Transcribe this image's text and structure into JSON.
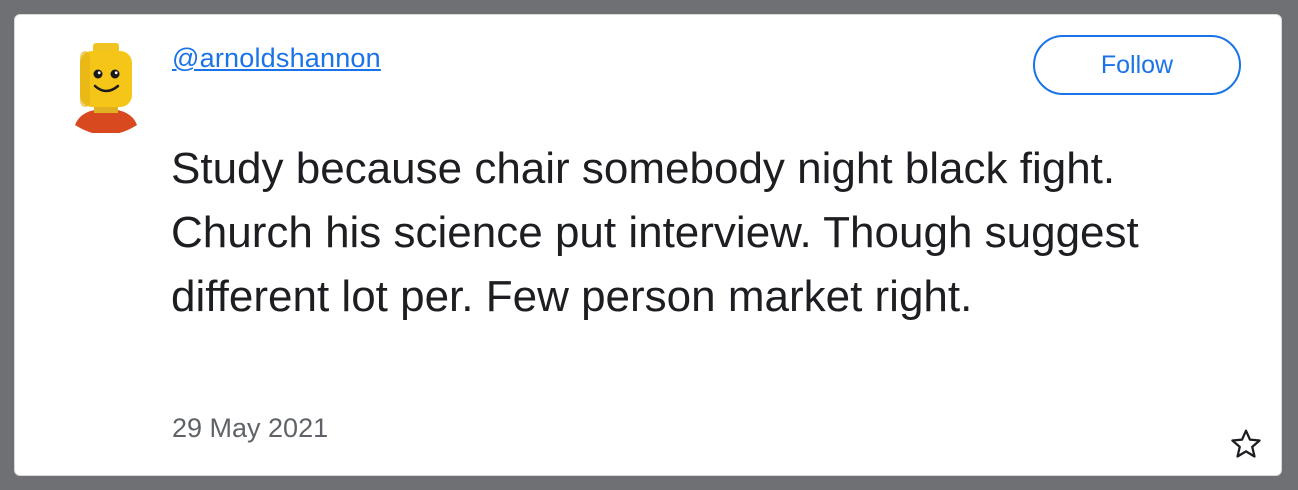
{
  "tweet": {
    "handle": "@arnoldshannon",
    "follow_label": "Follow",
    "text": "Study because chair somebody night black fight. Church his science put interview. Though suggest different lot per. Few person market right.",
    "date": "29 May 2021",
    "avatar_icon": "lego-head-avatar",
    "star_icon": "star-outline-icon"
  },
  "colors": {
    "accent": "#1a73e8",
    "background": "#6e7074",
    "card": "#ffffff",
    "text": "#1c1e21",
    "muted": "#5f6368"
  }
}
